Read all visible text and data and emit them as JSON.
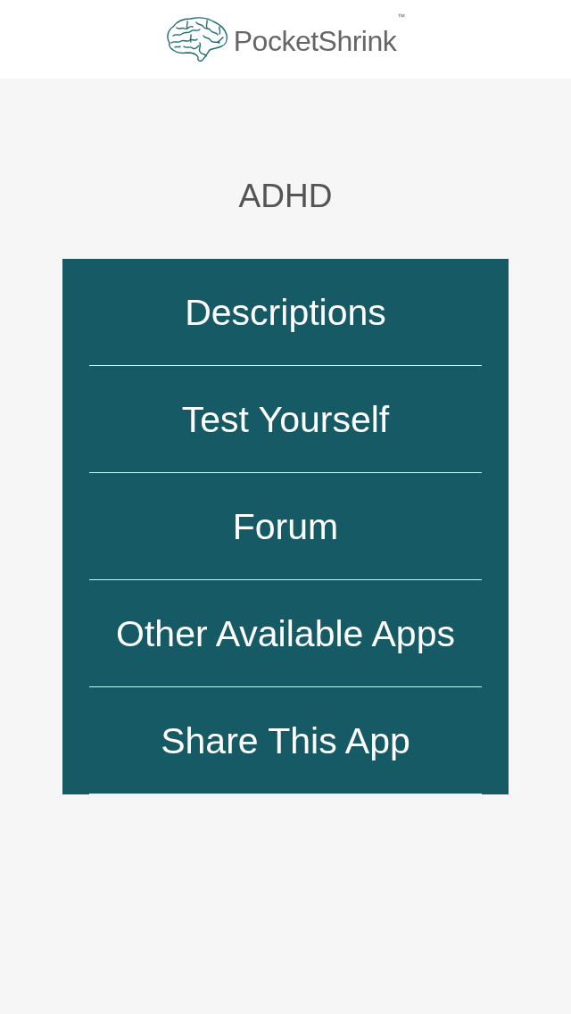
{
  "header": {
    "logo": {
      "name": "PocketShrink",
      "trademark": "™"
    }
  },
  "title": "ADHD",
  "menu": {
    "items": [
      {
        "label": "Descriptions"
      },
      {
        "label": "Test Yourself"
      },
      {
        "label": "Forum"
      },
      {
        "label": "Other Available Apps"
      },
      {
        "label": "Share This App"
      }
    ]
  }
}
